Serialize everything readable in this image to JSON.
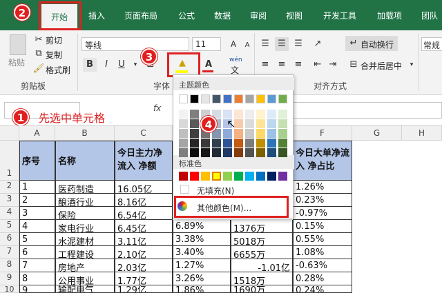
{
  "tabs": [
    "开始",
    "插入",
    "页面布局",
    "公式",
    "数据",
    "审阅",
    "视图",
    "开发工具",
    "加载项",
    "团队"
  ],
  "clipboard": {
    "paste": "粘贴",
    "cut": "剪切",
    "copy": "复制",
    "format_painter": "格式刷",
    "group": "剪贴板"
  },
  "font": {
    "name": "等线",
    "size": "11",
    "group": "字体",
    "bold": "B",
    "italic": "I",
    "underline": "U",
    "wen": "wén",
    "wen_char": "文"
  },
  "alignment": {
    "wrap": "自动换行",
    "merge": "合并后居中",
    "group": "对齐方式"
  },
  "number": {
    "format": "常规"
  },
  "formula": {
    "fx": "fx",
    "callout": "先选中单元格"
  },
  "steps": [
    "1",
    "2",
    "3",
    "4"
  ],
  "color_menu": {
    "theme_title": "主题颜色",
    "standard_title": "标准色",
    "no_fill": "无填充(N)",
    "more_colors": "其他颜色(M)...",
    "theme_colors": [
      [
        "#ffffff",
        "#000000",
        "#e7e6e6",
        "#44546a",
        "#4472c4",
        "#ed7d31",
        "#a5a5a5",
        "#ffc000",
        "#5b9bd5",
        "#70ad47"
      ],
      [
        "#f2f2f2",
        "#7f7f7f",
        "#d0cece",
        "#d6dce4",
        "#d9e2f3",
        "#fbe5d5",
        "#ededed",
        "#fff2cc",
        "#deebf6",
        "#e2efd9"
      ],
      [
        "#d8d8d8",
        "#595959",
        "#aeabab",
        "#adb9ca",
        "#b4c6e7",
        "#f7cbac",
        "#dbdbdb",
        "#fee599",
        "#bdd7ee",
        "#c5e0b3"
      ],
      [
        "#bfbfbf",
        "#3f3f3f",
        "#757171",
        "#8496b0",
        "#8eaadb",
        "#f4b183",
        "#c9c9c9",
        "#ffd966",
        "#9cc3e5",
        "#a8d08d"
      ],
      [
        "#a5a5a5",
        "#262626",
        "#3a3838",
        "#323f4f",
        "#2f5496",
        "#c55a11",
        "#7b7b7b",
        "#bf9000",
        "#2e75b5",
        "#538135"
      ],
      [
        "#7f7f7f",
        "#0d0d0d",
        "#171616",
        "#222a35",
        "#1f3864",
        "#833c0b",
        "#525252",
        "#7f6000",
        "#1e4e79",
        "#375623"
      ]
    ],
    "standard_colors": [
      "#c00000",
      "#ff0000",
      "#ffc000",
      "#ffff00",
      "#92d050",
      "#00b050",
      "#00b0f0",
      "#0070c0",
      "#002060",
      "#7030a0"
    ]
  },
  "columns": [
    "A",
    "B",
    "C",
    "D",
    "E",
    "F",
    "G",
    "H"
  ],
  "rows": [
    "1",
    "2",
    "3",
    "4",
    "5",
    "6",
    "7",
    "8",
    "9",
    "10"
  ],
  "table": {
    "headers": [
      "序号",
      "名称",
      "今日主力净流入 净额",
      "",
      "",
      "今日大单净流入 净占比"
    ],
    "rows": [
      [
        "1",
        "医药制造",
        "16.05亿",
        "",
        "",
        "1.26%"
      ],
      [
        "2",
        "酿酒行业",
        "8.16亿",
        "",
        "",
        "0.23%"
      ],
      [
        "3",
        "保险",
        "6.54亿",
        "",
        "",
        "-0.97%"
      ],
      [
        "4",
        "家电行业",
        "6.45亿",
        "6.89%",
        "1376万",
        "0.15%"
      ],
      [
        "5",
        "水泥建材",
        "3.11亿",
        "3.38%",
        "5018万",
        "0.55%"
      ],
      [
        "6",
        "工程建设",
        "2.10亿",
        "3.40%",
        "6655万",
        "1.08%"
      ],
      [
        "7",
        "房地产",
        "2.03亿",
        "1.27%",
        "-1.01亿",
        "-0.63%"
      ],
      [
        "8",
        "公用事业",
        "1.77亿",
        "3.26%",
        "1518万",
        "0.28%"
      ],
      [
        "9",
        "输配电气",
        "1.29亿",
        "1.86%",
        "1690万",
        "0.24%"
      ]
    ]
  }
}
